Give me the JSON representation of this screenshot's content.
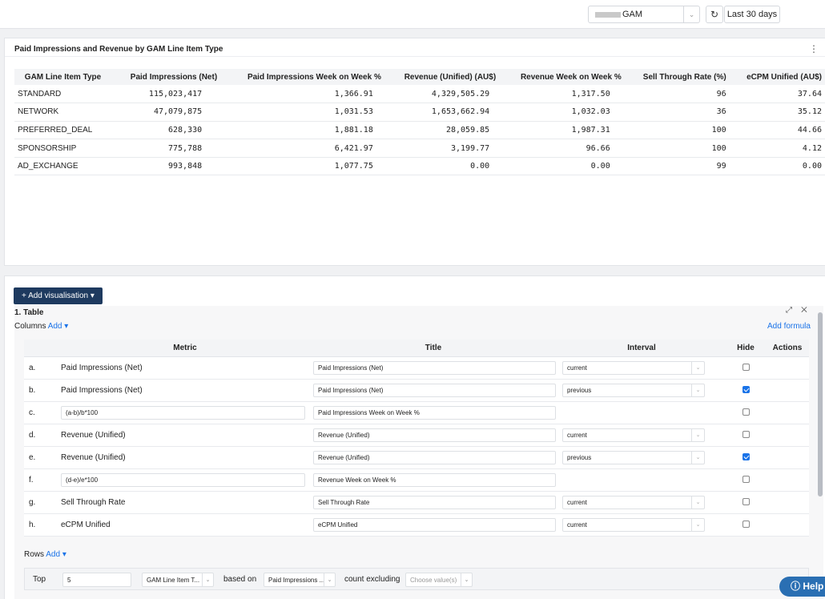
{
  "topbar": {
    "account_value": "GAM",
    "date_range": "Last 30 days"
  },
  "report": {
    "title": "Paid Impressions and Revenue by GAM Line Item Type",
    "columns": [
      "GAM Line Item Type",
      "Paid Impressions (Net)",
      "Paid Impressions Week on Week %",
      "Revenue (Unified) (AU$)",
      "Revenue Week on Week %",
      "Sell Through Rate (%)",
      "eCPM Unified (AU$)"
    ],
    "rows": [
      [
        "STANDARD",
        "115,023,417",
        "1,366.91",
        "4,329,505.29",
        "1,317.50",
        "96",
        "37.64"
      ],
      [
        "NETWORK",
        "47,079,875",
        "1,031.53",
        "1,653,662.94",
        "1,032.03",
        "36",
        "35.12"
      ],
      [
        "PREFERRED_DEAL",
        "628,330",
        "1,881.18",
        "28,059.85",
        "1,987.31",
        "100",
        "44.66"
      ],
      [
        "SPONSORSHIP",
        "775,788",
        "6,421.97",
        "3,199.77",
        "96.66",
        "100",
        "4.12"
      ],
      [
        "AD_EXCHANGE",
        "993,848",
        "1,077.75",
        "0.00",
        "0.00",
        "99",
        "0.00"
      ]
    ]
  },
  "builder": {
    "add_vis_label": "+ Add visualisation ▾",
    "block_title": "1. Table",
    "columns_label": "Columns",
    "add_label": "Add ▾",
    "add_formula": "Add formula",
    "headers": {
      "metric": "Metric",
      "title": "Title",
      "interval": "Interval",
      "hide": "Hide",
      "actions": "Actions"
    },
    "items": [
      {
        "letter": "a.",
        "metric": "Paid Impressions (Net)",
        "title": "Paid Impressions (Net)",
        "interval": "current",
        "hidden": false,
        "formula": false
      },
      {
        "letter": "b.",
        "metric": "Paid Impressions (Net)",
        "title": "Paid Impressions (Net)",
        "interval": "previous",
        "hidden": true,
        "formula": false
      },
      {
        "letter": "c.",
        "metric": "(a-b)/b*100",
        "title": "Paid Impressions Week on Week %",
        "interval": "",
        "hidden": false,
        "formula": true
      },
      {
        "letter": "d.",
        "metric": "Revenue (Unified)",
        "title": "Revenue (Unified)",
        "interval": "current",
        "hidden": false,
        "formula": false
      },
      {
        "letter": "e.",
        "metric": "Revenue (Unified)",
        "title": "Revenue (Unified)",
        "interval": "previous",
        "hidden": true,
        "formula": false
      },
      {
        "letter": "f.",
        "metric": "(d-e)/e*100",
        "title": "Revenue Week on Week %",
        "interval": "",
        "hidden": false,
        "formula": true
      },
      {
        "letter": "g.",
        "metric": "Sell Through Rate",
        "title": "Sell Through Rate",
        "interval": "current",
        "hidden": false,
        "formula": false
      },
      {
        "letter": "h.",
        "metric": "eCPM Unified",
        "title": "eCPM Unified",
        "interval": "current",
        "hidden": false,
        "formula": false
      }
    ],
    "rows_label": "Rows",
    "rows_add": "Add ▾",
    "top_label": "Top",
    "top_value": "5",
    "dimension_value": "GAM Line Item T...",
    "based_on_label": "based on",
    "based_on_value": "Paid Impressions ...",
    "count_excluding_label": "count excluding",
    "choose_placeholder": "Choose value(s)"
  },
  "help": {
    "label": "Help"
  }
}
